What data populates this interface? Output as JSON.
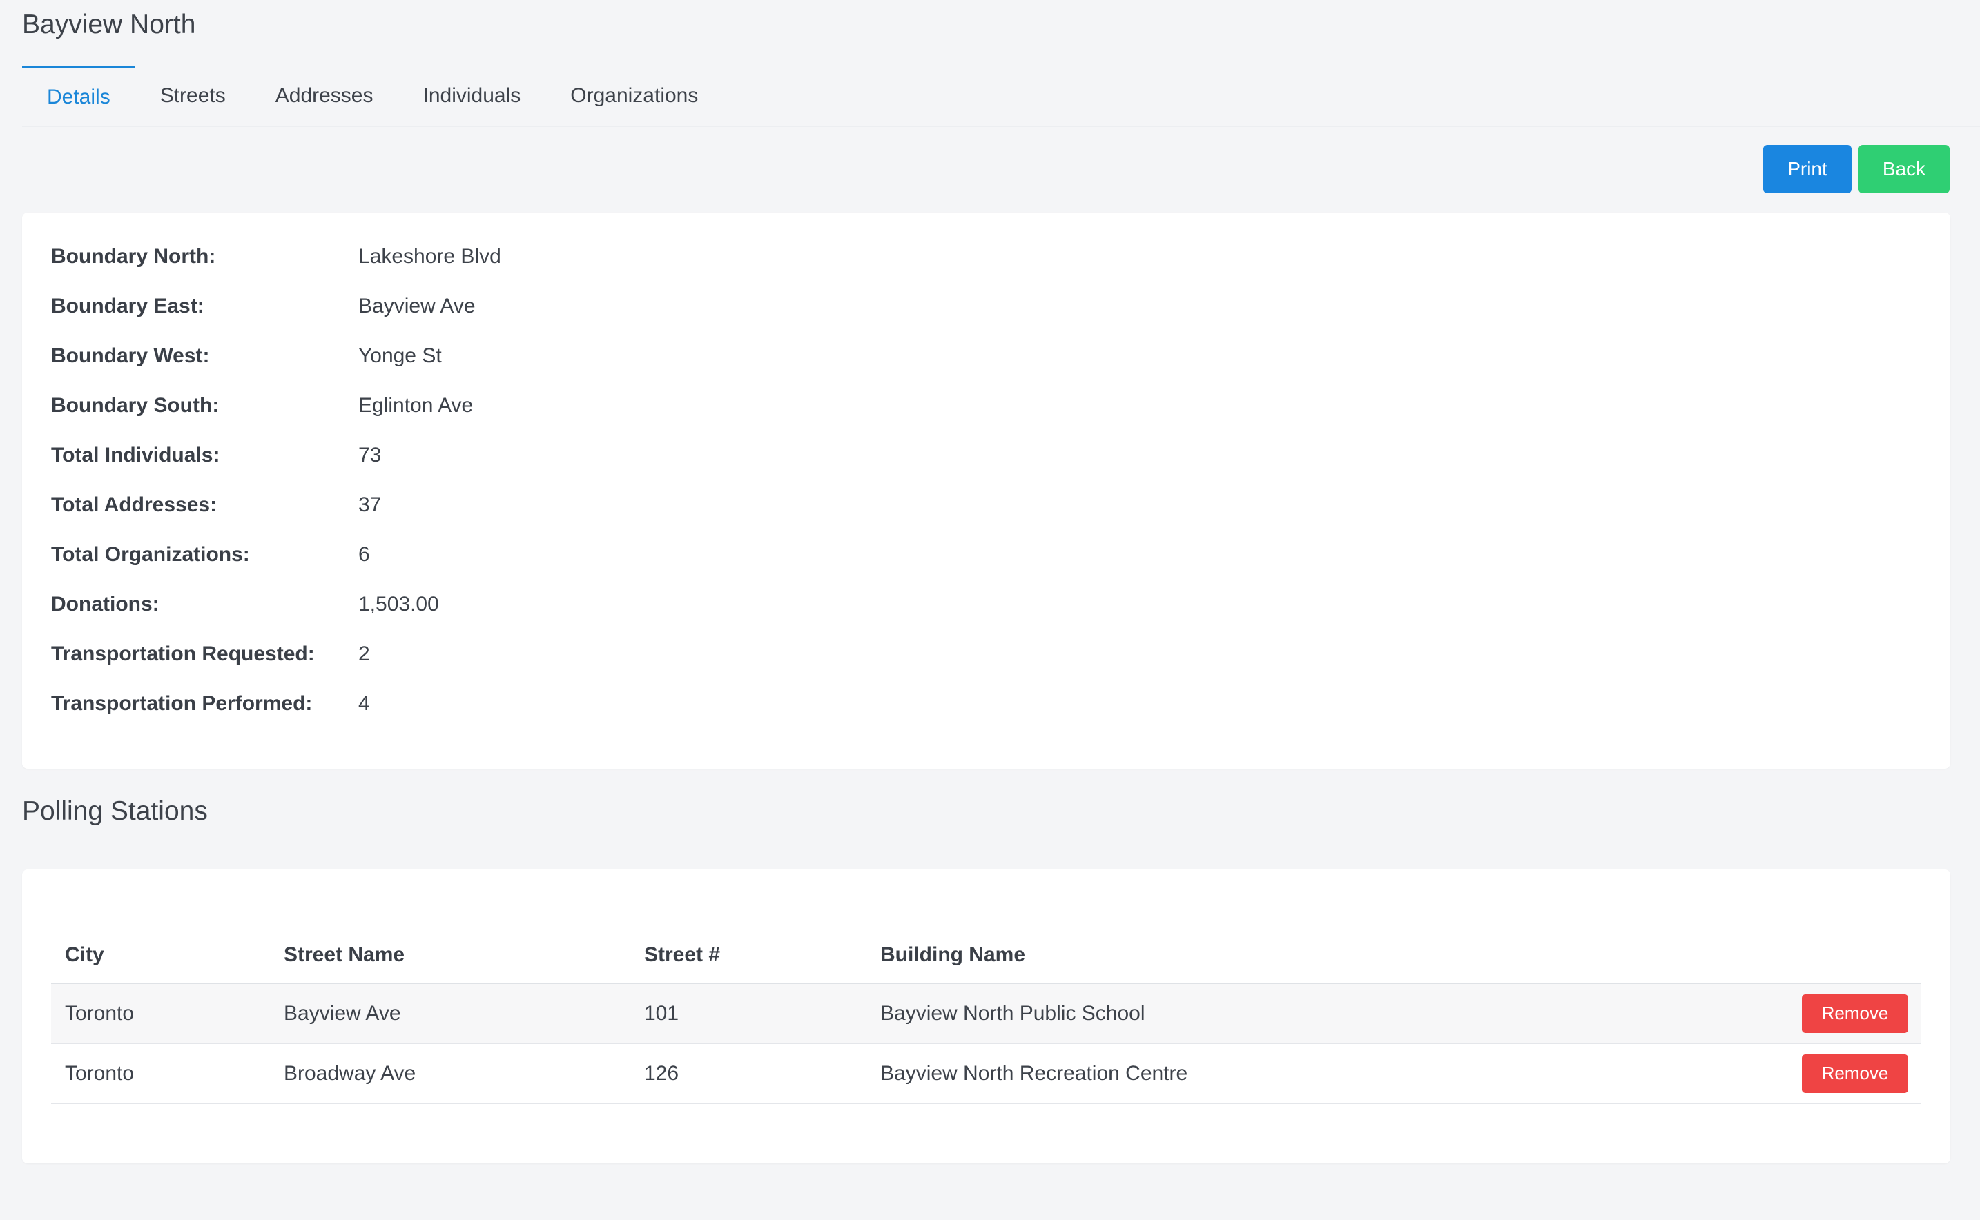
{
  "page": {
    "title": "Bayview North"
  },
  "tabs": [
    {
      "label": "Details",
      "active": true
    },
    {
      "label": "Streets",
      "active": false
    },
    {
      "label": "Addresses",
      "active": false
    },
    {
      "label": "Individuals",
      "active": false
    },
    {
      "label": "Organizations",
      "active": false
    }
  ],
  "toolbar": {
    "print_label": "Print",
    "back_label": "Back"
  },
  "details": [
    {
      "label": "Boundary North:",
      "value": "Lakeshore Blvd"
    },
    {
      "label": "Boundary East:",
      "value": "Bayview Ave"
    },
    {
      "label": "Boundary West:",
      "value": "Yonge St"
    },
    {
      "label": "Boundary South:",
      "value": "Eglinton Ave"
    },
    {
      "label": "Total Individuals:",
      "value": "73"
    },
    {
      "label": "Total Addresses:",
      "value": "37"
    },
    {
      "label": "Total Organizations:",
      "value": "6"
    },
    {
      "label": "Donations:",
      "value": "1,503.00"
    },
    {
      "label": "Transportation Requested:",
      "value": "2"
    },
    {
      "label": "Transportation Performed:",
      "value": "4"
    }
  ],
  "polling_stations": {
    "title": "Polling Stations",
    "columns": [
      "City",
      "Street Name",
      "Street #",
      "Building Name"
    ],
    "rows": [
      {
        "city": "Toronto",
        "street_name": "Bayview Ave",
        "street_number": "101",
        "building_name": "Bayview North Public School",
        "action_label": "Remove"
      },
      {
        "city": "Toronto",
        "street_name": "Broadway Ave",
        "street_number": "126",
        "building_name": "Bayview North Recreation Centre",
        "action_label": "Remove"
      }
    ]
  },
  "colors": {
    "accent": "#1a86d8",
    "print_button": "#1a86e0",
    "back_button": "#2fcf73",
    "remove_button": "#ef4444",
    "background": "#f4f5f7"
  }
}
